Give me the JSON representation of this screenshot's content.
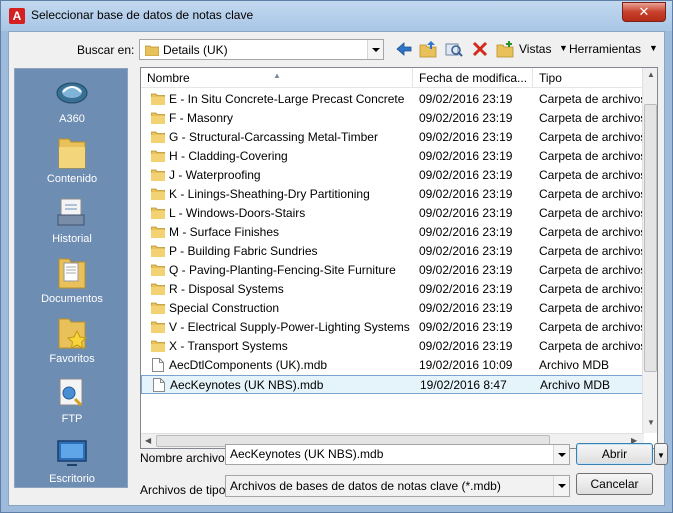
{
  "window": {
    "title": "Seleccionar base de datos de notas clave",
    "app_icon_letter": "A",
    "close_glyph": "✕"
  },
  "toolbar": {
    "lookin_label": "Buscar en:",
    "lookin_value": "Details (UK)",
    "views_label": "Vistas",
    "tools_label": "Herramientas"
  },
  "places": [
    {
      "label": "A360",
      "icon": "a360-cloud-icon"
    },
    {
      "label": "Contenido",
      "icon": "folder-icon"
    },
    {
      "label": "Historial",
      "icon": "history-icon"
    },
    {
      "label": "Documentos",
      "icon": "documents-icon"
    },
    {
      "label": "Favoritos",
      "icon": "favorites-icon"
    },
    {
      "label": "FTP",
      "icon": "ftp-icon"
    },
    {
      "label": "Escritorio",
      "icon": "desktop-icon"
    }
  ],
  "columns": {
    "name": "Nombre",
    "date": "Fecha de modifica...",
    "type": "Tipo"
  },
  "files": [
    {
      "name": "E - In Situ Concrete-Large Precast Concrete",
      "date": "09/02/2016 23:19",
      "type": "Carpeta de archivos",
      "kind": "folder"
    },
    {
      "name": "F - Masonry",
      "date": "09/02/2016 23:19",
      "type": "Carpeta de archivos",
      "kind": "folder"
    },
    {
      "name": "G - Structural-Carcassing Metal-Timber",
      "date": "09/02/2016 23:19",
      "type": "Carpeta de archivos",
      "kind": "folder"
    },
    {
      "name": "H - Cladding-Covering",
      "date": "09/02/2016 23:19",
      "type": "Carpeta de archivos",
      "kind": "folder"
    },
    {
      "name": "J - Waterproofing",
      "date": "09/02/2016 23:19",
      "type": "Carpeta de archivos",
      "kind": "folder"
    },
    {
      "name": "K - Linings-Sheathing-Dry Partitioning",
      "date": "09/02/2016 23:19",
      "type": "Carpeta de archivos",
      "kind": "folder"
    },
    {
      "name": "L - Windows-Doors-Stairs",
      "date": "09/02/2016 23:19",
      "type": "Carpeta de archivos",
      "kind": "folder"
    },
    {
      "name": "M - Surface Finishes",
      "date": "09/02/2016 23:19",
      "type": "Carpeta de archivos",
      "kind": "folder"
    },
    {
      "name": "P - Building Fabric Sundries",
      "date": "09/02/2016 23:19",
      "type": "Carpeta de archivos",
      "kind": "folder"
    },
    {
      "name": "Q - Paving-Planting-Fencing-Site Furniture",
      "date": "09/02/2016 23:19",
      "type": "Carpeta de archivos",
      "kind": "folder"
    },
    {
      "name": "R - Disposal Systems",
      "date": "09/02/2016 23:19",
      "type": "Carpeta de archivos",
      "kind": "folder"
    },
    {
      "name": "Special Construction",
      "date": "09/02/2016 23:19",
      "type": "Carpeta de archivos",
      "kind": "folder"
    },
    {
      "name": "V - Electrical Supply-Power-Lighting Systems",
      "date": "09/02/2016 23:19",
      "type": "Carpeta de archivos",
      "kind": "folder"
    },
    {
      "name": "X - Transport Systems",
      "date": "09/02/2016 23:19",
      "type": "Carpeta de archivos",
      "kind": "folder"
    },
    {
      "name": "AecDtlComponents (UK).mdb",
      "date": "19/02/2016 10:09",
      "type": "Archivo MDB",
      "kind": "file"
    },
    {
      "name": "AecKeynotes (UK NBS).mdb",
      "date": "19/02/2016 8:47",
      "type": "Archivo MDB",
      "kind": "file",
      "selected": true
    }
  ],
  "filename": {
    "label": "Nombre archivo:",
    "value": "AecKeynotes (UK NBS).mdb"
  },
  "filetype": {
    "label": "Archivos de tipo:",
    "value": "Archivos de bases de datos de notas clave (*.mdb)"
  },
  "buttons": {
    "open": "Abrir",
    "cancel": "Cancelar"
  },
  "colors": {
    "accent": "#3c7fb1",
    "places_bg": "#6e8db3",
    "selection": "#e5f3fb"
  }
}
